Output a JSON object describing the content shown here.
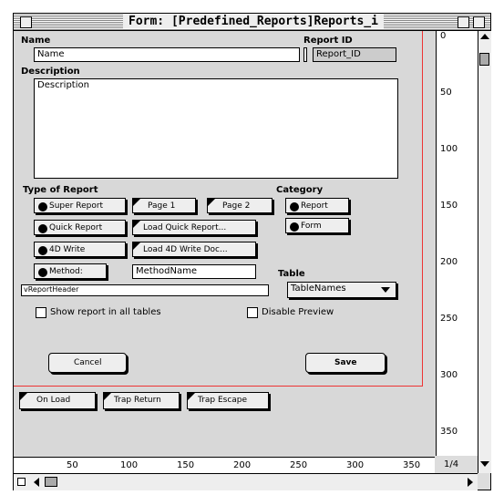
{
  "window": {
    "title": "Form: [Predefined_Reports]Reports_i"
  },
  "form": {
    "name_label": "Name",
    "name_value": "Name",
    "report_id_label": "Report ID",
    "report_id_value": "Report_ID",
    "description_label": "Description",
    "description_value": "Description",
    "type_label": "Type of Report",
    "category_label": "Category",
    "buttons": {
      "super_report": "Super Report",
      "page1": "Page 1",
      "page2": "Page 2",
      "quick_report": "Quick Report",
      "load_quick_report": "Load Quick Report...",
      "write_4d": "4D Write",
      "load_4d_write": "Load 4D Write Doc...",
      "method": "Method:",
      "report": "Report",
      "form": "Form",
      "cancel": "Cancel",
      "save": "Save",
      "on_load": "On Load",
      "trap_return": "Trap Return",
      "trap_escape": "Trap Escape"
    },
    "method_name": "MethodName",
    "variable_field": "vReportHeader",
    "table_label": "Table",
    "table_dropdown": "TableNames",
    "show_all_tables": "Show report in all tables",
    "disable_preview": "Disable Preview"
  },
  "rulers": {
    "vertical": [
      "0",
      "50",
      "100",
      "150",
      "200",
      "250",
      "300",
      "350"
    ],
    "horizontal": [
      "50",
      "100",
      "150",
      "200",
      "250",
      "300",
      "350"
    ],
    "page": "1/4"
  }
}
